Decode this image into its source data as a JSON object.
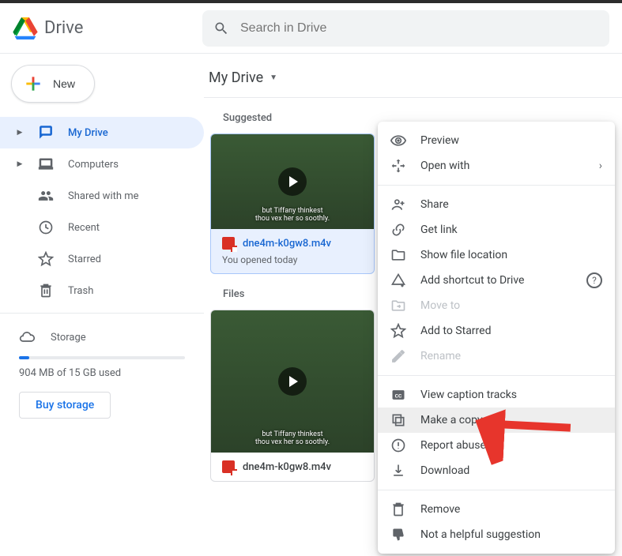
{
  "app": {
    "name": "Drive"
  },
  "search": {
    "placeholder": "Search in Drive"
  },
  "sidebar": {
    "newLabel": "New",
    "items": [
      {
        "label": "My Drive"
      },
      {
        "label": "Computers"
      },
      {
        "label": "Shared with me"
      },
      {
        "label": "Recent"
      },
      {
        "label": "Starred"
      },
      {
        "label": "Trash"
      }
    ],
    "storage": {
      "label": "Storage",
      "usage": "904 MB of 15 GB used",
      "buy": "Buy storage"
    }
  },
  "main": {
    "location": "My Drive",
    "suggestedLabel": "Suggested",
    "filesLabel": "Files",
    "suggested": {
      "title": "dne4m-k0gw8.m4v",
      "sub": "You opened today",
      "caption1": "but Tiffany thinkest",
      "caption2": "thou vex her so soothly."
    },
    "file": {
      "title": "dne4m-k0gw8.m4v",
      "caption1": "but Tiffany thinkest",
      "caption2": "thou vex her so soothly."
    }
  },
  "context": [
    {
      "key": "preview",
      "label": "Preview"
    },
    {
      "key": "openwith",
      "label": "Open with"
    },
    {
      "key": "share",
      "label": "Share"
    },
    {
      "key": "getlink",
      "label": "Get link"
    },
    {
      "key": "showloc",
      "label": "Show file location"
    },
    {
      "key": "shortcut",
      "label": "Add shortcut to Drive"
    },
    {
      "key": "moveto",
      "label": "Move to"
    },
    {
      "key": "star",
      "label": "Add to Starred"
    },
    {
      "key": "rename",
      "label": "Rename"
    },
    {
      "key": "captions",
      "label": "View caption tracks"
    },
    {
      "key": "copy",
      "label": "Make a copy"
    },
    {
      "key": "report",
      "label": "Report abuse"
    },
    {
      "key": "download",
      "label": "Download"
    },
    {
      "key": "remove",
      "label": "Remove"
    },
    {
      "key": "nothelpful",
      "label": "Not a helpful suggestion"
    }
  ]
}
